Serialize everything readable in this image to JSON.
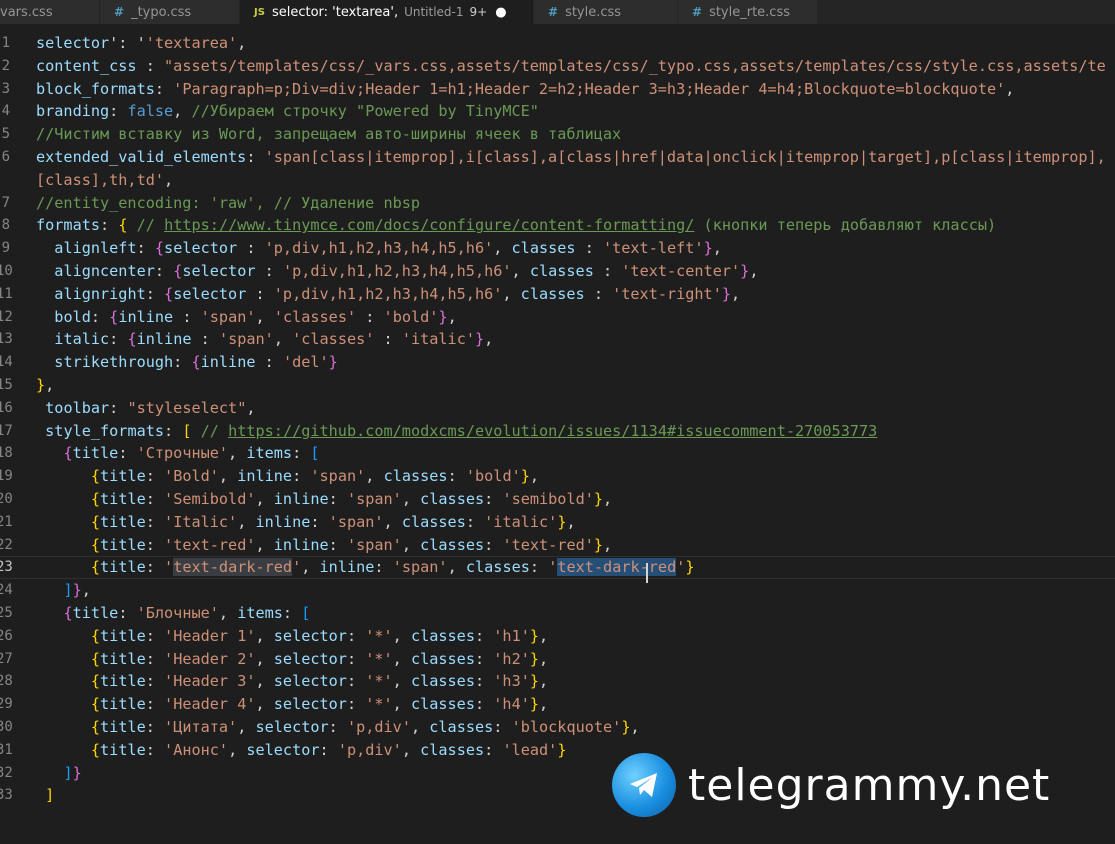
{
  "tabs": [
    {
      "icon": "",
      "name": "vars.css",
      "desc": "",
      "badge": "",
      "dirty": "",
      "active": false
    },
    {
      "icon": "#",
      "name": "_typo.css",
      "desc": "",
      "badge": "",
      "dirty": "",
      "active": false
    },
    {
      "icon": "JS",
      "name": "selector: 'textarea',",
      "desc": "Untitled-1",
      "badge": "9+",
      "dirty": "●",
      "active": true
    },
    {
      "icon": "#",
      "name": "style.css",
      "desc": "",
      "badge": "",
      "dirty": "",
      "active": false
    },
    {
      "icon": "#",
      "name": "style_rte.css",
      "desc": "",
      "badge": "",
      "dirty": "",
      "active": false
    }
  ],
  "lines": [
    {
      "n": "1",
      "t": [
        [
          "p",
          "selector"
        ],
        [
          "",
          "': '"
        ],
        [
          "s",
          "'textarea'"
        ],
        [
          "",
          ","
        ]
      ]
    },
    {
      "n": "2",
      "t": [
        [
          "p",
          "content_css"
        ],
        [
          "",
          " : "
        ],
        [
          "s",
          "\"assets/templates/css/_vars.css,assets/templates/css/_typo.css,assets/templates/css/style.css,assets/te"
        ]
      ]
    },
    {
      "n": "3",
      "t": [
        [
          "p",
          "block_formats"
        ],
        [
          "",
          ": "
        ],
        [
          "s",
          "'Paragraph=p;Div=div;Header 1=h1;Header 2=h2;Header 3=h3;Header 4=h4;Blockquote=blockquote'"
        ],
        [
          "",
          ","
        ]
      ]
    },
    {
      "n": "4",
      "t": [
        [
          "p",
          "branding"
        ],
        [
          "",
          ": "
        ],
        [
          "k",
          "false"
        ],
        [
          "",
          ", "
        ],
        [
          "c",
          "//Убираем строчку \"Powered by TinyMCE\""
        ]
      ]
    },
    {
      "n": "5",
      "t": [
        [
          "c",
          "//Чистим вставку из Word, запрещаем авто-ширины ячеек в таблицах"
        ]
      ]
    },
    {
      "n": "6",
      "t": [
        [
          "p",
          "extended_valid_elements"
        ],
        [
          "",
          ": "
        ],
        [
          "s",
          "'span[class|itemprop],i[class],a[class|href|data|onclick|itemprop|target],p[class|itemprop],"
        ]
      ]
    },
    {
      "n": "",
      "t": [
        [
          "s",
          "[class],th,td'"
        ],
        [
          "",
          ","
        ]
      ]
    },
    {
      "n": "7",
      "t": [
        [
          "c",
          "//entity_encoding: 'raw', // Удаление nbsp"
        ]
      ]
    },
    {
      "n": "8",
      "t": [
        [
          "p",
          "formats"
        ],
        [
          "",
          ": "
        ],
        [
          "b1",
          "{"
        ],
        [
          "",
          " "
        ],
        [
          "c",
          "// "
        ],
        [
          "u",
          "https://www.tinymce.com/docs/configure/content-formatting/"
        ],
        [
          "c",
          " (кнопки теперь добавляют классы)"
        ]
      ]
    },
    {
      "n": "9",
      "t": [
        [
          "ws",
          "  "
        ],
        [
          "p",
          "alignleft"
        ],
        [
          "",
          ": "
        ],
        [
          "b2",
          "{"
        ],
        [
          "p",
          "selector"
        ],
        [
          "",
          " : "
        ],
        [
          "s",
          "'p,div,h1,h2,h3,h4,h5,h6'"
        ],
        [
          "",
          ", "
        ],
        [
          "p",
          "classes"
        ],
        [
          "",
          " : "
        ],
        [
          "s",
          "'text-left'"
        ],
        [
          "b2",
          "}"
        ],
        [
          "",
          ","
        ]
      ]
    },
    {
      "n": "10",
      "t": [
        [
          "ws",
          "  "
        ],
        [
          "p",
          "aligncenter"
        ],
        [
          "",
          ": "
        ],
        [
          "b2",
          "{"
        ],
        [
          "p",
          "selector"
        ],
        [
          "",
          " : "
        ],
        [
          "s",
          "'p,div,h1,h2,h3,h4,h5,h6'"
        ],
        [
          "",
          ", "
        ],
        [
          "p",
          "classes"
        ],
        [
          "",
          " : "
        ],
        [
          "s",
          "'text-center'"
        ],
        [
          "b2",
          "}"
        ],
        [
          "",
          ","
        ]
      ]
    },
    {
      "n": "11",
      "t": [
        [
          "ws",
          "  "
        ],
        [
          "p",
          "alignright"
        ],
        [
          "",
          ": "
        ],
        [
          "b2",
          "{"
        ],
        [
          "p",
          "selector"
        ],
        [
          "",
          " : "
        ],
        [
          "s",
          "'p,div,h1,h2,h3,h4,h5,h6'"
        ],
        [
          "",
          ", "
        ],
        [
          "p",
          "classes"
        ],
        [
          "",
          " : "
        ],
        [
          "s",
          "'text-right'"
        ],
        [
          "b2",
          "}"
        ],
        [
          "",
          ","
        ]
      ]
    },
    {
      "n": "12",
      "t": [
        [
          "ws",
          "  "
        ],
        [
          "p",
          "bold"
        ],
        [
          "",
          ": "
        ],
        [
          "b2",
          "{"
        ],
        [
          "p",
          "inline"
        ],
        [
          "",
          " : "
        ],
        [
          "s",
          "'span'"
        ],
        [
          "",
          ", "
        ],
        [
          "s",
          "'classes'"
        ],
        [
          "",
          " : "
        ],
        [
          "s",
          "'bold'"
        ],
        [
          "b2",
          "}"
        ],
        [
          "",
          ","
        ]
      ]
    },
    {
      "n": "13",
      "t": [
        [
          "ws",
          "  "
        ],
        [
          "p",
          "italic"
        ],
        [
          "",
          ": "
        ],
        [
          "b2",
          "{"
        ],
        [
          "p",
          "inline"
        ],
        [
          "",
          " : "
        ],
        [
          "s",
          "'span'"
        ],
        [
          "",
          ", "
        ],
        [
          "s",
          "'classes'"
        ],
        [
          "",
          " : "
        ],
        [
          "s",
          "'italic'"
        ],
        [
          "b2",
          "}"
        ],
        [
          "",
          ","
        ]
      ]
    },
    {
      "n": "14",
      "t": [
        [
          "ws",
          "  "
        ],
        [
          "p",
          "strikethrough"
        ],
        [
          "",
          ": "
        ],
        [
          "b2",
          "{"
        ],
        [
          "p",
          "inline"
        ],
        [
          "",
          " : "
        ],
        [
          "s",
          "'del'"
        ],
        [
          "b2",
          "}"
        ]
      ]
    },
    {
      "n": "15",
      "t": [
        [
          "b1",
          "}"
        ],
        [
          "",
          ","
        ]
      ]
    },
    {
      "n": "16",
      "t": [
        [
          "ws",
          " "
        ],
        [
          "p",
          "toolbar"
        ],
        [
          "",
          ": "
        ],
        [
          "s",
          "\"styleselect\""
        ],
        [
          "",
          ","
        ]
      ]
    },
    {
      "n": "17",
      "t": [
        [
          "ws",
          " "
        ],
        [
          "p",
          "style_formats"
        ],
        [
          "",
          ": "
        ],
        [
          "b1",
          "["
        ],
        [
          "",
          " "
        ],
        [
          "c",
          "// "
        ],
        [
          "u",
          "https://github.com/modxcms/evolution/issues/1134#issuecomment-270053773"
        ]
      ]
    },
    {
      "n": "18",
      "t": [
        [
          "ws",
          "   "
        ],
        [
          "b2",
          "{"
        ],
        [
          "p",
          "title"
        ],
        [
          "",
          ": "
        ],
        [
          "s",
          "'Строчные'"
        ],
        [
          "",
          ", "
        ],
        [
          "p",
          "items"
        ],
        [
          "",
          ": "
        ],
        [
          "b3",
          "["
        ]
      ]
    },
    {
      "n": "19",
      "t": [
        [
          "ws",
          "      "
        ],
        [
          "b1",
          "{"
        ],
        [
          "p",
          "title"
        ],
        [
          "",
          ": "
        ],
        [
          "s",
          "'Bold'"
        ],
        [
          "",
          ", "
        ],
        [
          "p",
          "inline"
        ],
        [
          "",
          ": "
        ],
        [
          "s",
          "'span'"
        ],
        [
          "",
          ", "
        ],
        [
          "p",
          "classes"
        ],
        [
          "",
          ": "
        ],
        [
          "s",
          "'bold'"
        ],
        [
          "b1",
          "}"
        ],
        [
          "",
          ","
        ]
      ]
    },
    {
      "n": "20",
      "t": [
        [
          "ws",
          "      "
        ],
        [
          "b1",
          "{"
        ],
        [
          "p",
          "title"
        ],
        [
          "",
          ": "
        ],
        [
          "s",
          "'Semibold'"
        ],
        [
          "",
          ", "
        ],
        [
          "p",
          "inline"
        ],
        [
          "",
          ": "
        ],
        [
          "s",
          "'span'"
        ],
        [
          "",
          ", "
        ],
        [
          "p",
          "classes"
        ],
        [
          "",
          ": "
        ],
        [
          "s",
          "'semibold'"
        ],
        [
          "b1",
          "}"
        ],
        [
          "",
          ","
        ]
      ]
    },
    {
      "n": "21",
      "t": [
        [
          "ws",
          "      "
        ],
        [
          "b1",
          "{"
        ],
        [
          "p",
          "title"
        ],
        [
          "",
          ": "
        ],
        [
          "s",
          "'Italic'"
        ],
        [
          "",
          ", "
        ],
        [
          "p",
          "inline"
        ],
        [
          "",
          ": "
        ],
        [
          "s",
          "'span'"
        ],
        [
          "",
          ", "
        ],
        [
          "p",
          "classes"
        ],
        [
          "",
          ": "
        ],
        [
          "s",
          "'italic'"
        ],
        [
          "b1",
          "}"
        ],
        [
          "",
          ","
        ]
      ]
    },
    {
      "n": "22",
      "t": [
        [
          "ws",
          "      "
        ],
        [
          "b1",
          "{"
        ],
        [
          "p",
          "title"
        ],
        [
          "",
          ": "
        ],
        [
          "s",
          "'text-red'"
        ],
        [
          "",
          ", "
        ],
        [
          "p",
          "inline"
        ],
        [
          "",
          ": "
        ],
        [
          "s",
          "'span'"
        ],
        [
          "",
          ", "
        ],
        [
          "p",
          "classes"
        ],
        [
          "",
          ": "
        ],
        [
          "s",
          "'text-red'"
        ],
        [
          "b1",
          "}"
        ],
        [
          "",
          ","
        ]
      ]
    },
    {
      "n": "23",
      "current": true,
      "t": [
        [
          "ws",
          "      "
        ],
        [
          "b1",
          "{"
        ],
        [
          "p",
          "title"
        ],
        [
          "",
          ": "
        ],
        [
          "s",
          "'"
        ],
        [
          "shl",
          "text-dark-red"
        ],
        [
          "s",
          "'"
        ],
        [
          "",
          ", "
        ],
        [
          "p",
          "inline"
        ],
        [
          "",
          ": "
        ],
        [
          "s",
          "'span'"
        ],
        [
          "",
          ", "
        ],
        [
          "p",
          "classes"
        ],
        [
          "",
          ": "
        ],
        [
          "s",
          "'"
        ],
        [
          "ssel",
          "text-dark-red"
        ],
        [
          "s",
          "'"
        ],
        [
          "b1",
          "}"
        ]
      ]
    },
    {
      "n": "24",
      "t": [
        [
          "ws",
          "   "
        ],
        [
          "b3",
          "]"
        ],
        [
          "b2",
          "}"
        ],
        [
          "",
          ","
        ]
      ]
    },
    {
      "n": "25",
      "t": [
        [
          "ws",
          "   "
        ],
        [
          "b2",
          "{"
        ],
        [
          "p",
          "title"
        ],
        [
          "",
          ": "
        ],
        [
          "s",
          "'Блочные'"
        ],
        [
          "",
          ", "
        ],
        [
          "p",
          "items"
        ],
        [
          "",
          ": "
        ],
        [
          "b3",
          "["
        ]
      ]
    },
    {
      "n": "26",
      "t": [
        [
          "ws",
          "      "
        ],
        [
          "b1",
          "{"
        ],
        [
          "p",
          "title"
        ],
        [
          "",
          ": "
        ],
        [
          "s",
          "'Header 1'"
        ],
        [
          "",
          ", "
        ],
        [
          "p",
          "selector"
        ],
        [
          "",
          ": "
        ],
        [
          "s",
          "'*'"
        ],
        [
          "",
          ", "
        ],
        [
          "p",
          "classes"
        ],
        [
          "",
          ": "
        ],
        [
          "s",
          "'h1'"
        ],
        [
          "b1",
          "}"
        ],
        [
          "",
          ","
        ]
      ]
    },
    {
      "n": "27",
      "t": [
        [
          "ws",
          "      "
        ],
        [
          "b1",
          "{"
        ],
        [
          "p",
          "title"
        ],
        [
          "",
          ": "
        ],
        [
          "s",
          "'Header 2'"
        ],
        [
          "",
          ", "
        ],
        [
          "p",
          "selector"
        ],
        [
          "",
          ": "
        ],
        [
          "s",
          "'*'"
        ],
        [
          "",
          ", "
        ],
        [
          "p",
          "classes"
        ],
        [
          "",
          ": "
        ],
        [
          "s",
          "'h2'"
        ],
        [
          "b1",
          "}"
        ],
        [
          "",
          ","
        ]
      ]
    },
    {
      "n": "28",
      "t": [
        [
          "ws",
          "      "
        ],
        [
          "b1",
          "{"
        ],
        [
          "p",
          "title"
        ],
        [
          "",
          ": "
        ],
        [
          "s",
          "'Header 3'"
        ],
        [
          "",
          ", "
        ],
        [
          "p",
          "selector"
        ],
        [
          "",
          ": "
        ],
        [
          "s",
          "'*'"
        ],
        [
          "",
          ", "
        ],
        [
          "p",
          "classes"
        ],
        [
          "",
          ": "
        ],
        [
          "s",
          "'h3'"
        ],
        [
          "b1",
          "}"
        ],
        [
          "",
          ","
        ]
      ]
    },
    {
      "n": "29",
      "t": [
        [
          "ws",
          "      "
        ],
        [
          "b1",
          "{"
        ],
        [
          "p",
          "title"
        ],
        [
          "",
          ": "
        ],
        [
          "s",
          "'Header 4'"
        ],
        [
          "",
          ", "
        ],
        [
          "p",
          "selector"
        ],
        [
          "",
          ": "
        ],
        [
          "s",
          "'*'"
        ],
        [
          "",
          ", "
        ],
        [
          "p",
          "classes"
        ],
        [
          "",
          ": "
        ],
        [
          "s",
          "'h4'"
        ],
        [
          "b1",
          "}"
        ],
        [
          "",
          ","
        ]
      ]
    },
    {
      "n": "30",
      "t": [
        [
          "ws",
          "      "
        ],
        [
          "b1",
          "{"
        ],
        [
          "p",
          "title"
        ],
        [
          "",
          ": "
        ],
        [
          "s",
          "'Цитата'"
        ],
        [
          "",
          ", "
        ],
        [
          "p",
          "selector"
        ],
        [
          "",
          ": "
        ],
        [
          "s",
          "'p,div'"
        ],
        [
          "",
          ", "
        ],
        [
          "p",
          "classes"
        ],
        [
          "",
          ": "
        ],
        [
          "s",
          "'blockquote'"
        ],
        [
          "b1",
          "}"
        ],
        [
          "",
          ","
        ]
      ]
    },
    {
      "n": "31",
      "t": [
        [
          "ws",
          "      "
        ],
        [
          "b1",
          "{"
        ],
        [
          "p",
          "title"
        ],
        [
          "",
          ": "
        ],
        [
          "s",
          "'Анонс'"
        ],
        [
          "",
          ", "
        ],
        [
          "p",
          "selector"
        ],
        [
          "",
          ": "
        ],
        [
          "s",
          "'p,div'"
        ],
        [
          "",
          ", "
        ],
        [
          "p",
          "classes"
        ],
        [
          "",
          ": "
        ],
        [
          "s",
          "'lead'"
        ],
        [
          "b1",
          "}"
        ]
      ]
    },
    {
      "n": "32",
      "t": [
        [
          "ws",
          "   "
        ],
        [
          "b3",
          "]"
        ],
        [
          "b2",
          "}"
        ]
      ]
    },
    {
      "n": "33",
      "t": [
        [
          "ws",
          " "
        ],
        [
          "b1",
          "]"
        ]
      ]
    }
  ],
  "watermark": {
    "text": "telegrammy.net"
  }
}
